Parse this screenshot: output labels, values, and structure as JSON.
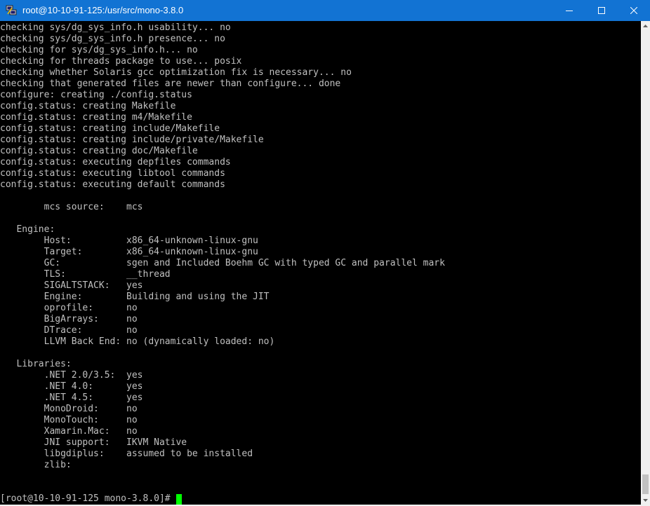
{
  "window": {
    "title": "root@10-10-91-125:/usr/src/mono-3.8.0",
    "app_icon": "putty-icon",
    "controls": [
      "minimize-icon",
      "maximize-icon",
      "close-icon"
    ],
    "titlebar_color": "#1273d3"
  },
  "terminal": {
    "background": "#000000",
    "foreground": "#c0c0c0",
    "cursor_color": "#00ff00",
    "lines": [
      "checking sys/dg_sys_info.h usability... no",
      "checking sys/dg_sys_info.h presence... no",
      "checking for sys/dg_sys_info.h... no",
      "checking for threads package to use... posix",
      "checking whether Solaris gcc optimization fix is necessary... no",
      "checking that generated files are newer than configure... done",
      "configure: creating ./config.status",
      "config.status: creating Makefile",
      "config.status: creating m4/Makefile",
      "config.status: creating include/Makefile",
      "config.status: creating include/private/Makefile",
      "config.status: creating doc/Makefile",
      "config.status: executing depfiles commands",
      "config.status: executing libtool commands",
      "config.status: executing default commands",
      "",
      "        mcs source:    mcs",
      "",
      "   Engine:",
      "        Host:          x86_64-unknown-linux-gnu",
      "        Target:        x86_64-unknown-linux-gnu",
      "        GC:            sgen and Included Boehm GC with typed GC and parallel mark",
      "        TLS:           __thread",
      "        SIGALTSTACK:   yes",
      "        Engine:        Building and using the JIT",
      "        oprofile:      no",
      "        BigArrays:     no",
      "        DTrace:        no",
      "        LLVM Back End: no (dynamically loaded: no)",
      "",
      "   Libraries:",
      "        .NET 2.0/3.5:  yes",
      "        .NET 4.0:      yes",
      "        .NET 4.5:      yes",
      "        MonoDroid:     no",
      "        MonoTouch:     no",
      "        Xamarin.Mac:   no",
      "        JNI support:   IKVM Native",
      "        libgdiplus:    assumed to be installed",
      "        zlib:",
      "",
      ""
    ],
    "prompt": "[root@10-10-91-125 mono-3.8.0]#"
  },
  "scrollbar": {
    "arrows": [
      "scroll-up-arrow-icon",
      "scroll-down-arrow-icon"
    ],
    "position": "bottom"
  }
}
